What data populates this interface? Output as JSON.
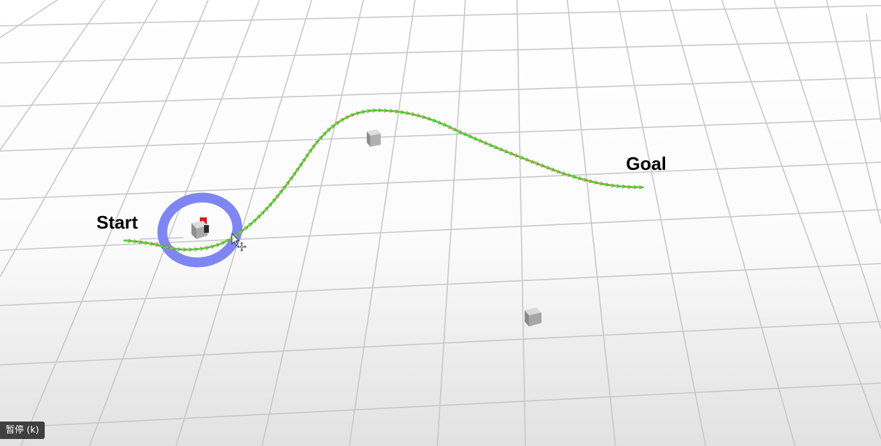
{
  "scene": {
    "start_label": "Start",
    "goal_label": "Goal"
  },
  "player": {
    "pause_hint": "暂停 (k)"
  },
  "colors": {
    "path_green": "#44e33a",
    "pose_arrow_red": "#d9533f",
    "ring_blue": "#7f86f2",
    "grid_line": "#c7c7c7",
    "obstacle_gray": "#a9a9a9"
  },
  "icons": {
    "mouse_cursor": "arrow-cursor-icon",
    "move_cursor": "move-cursor-icon"
  }
}
